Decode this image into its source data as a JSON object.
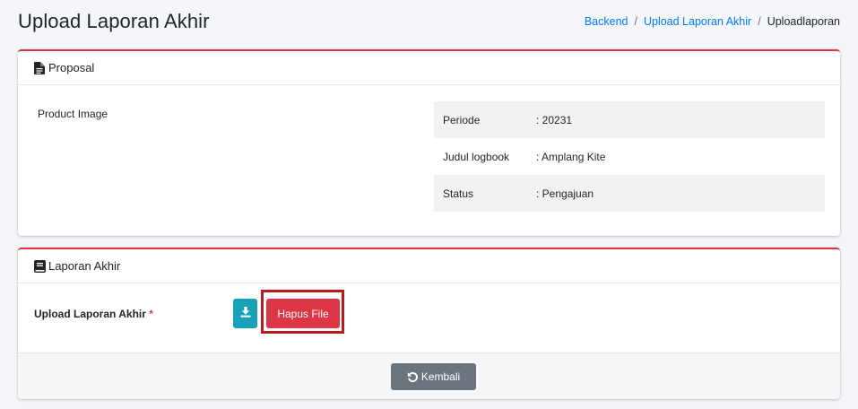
{
  "page": {
    "title": "Upload Laporan Akhir",
    "breadcrumb": {
      "items": [
        "Backend",
        "Upload Laporan Akhir"
      ],
      "current": "Uploadlaporan",
      "separator": "/"
    }
  },
  "proposal": {
    "header": "Proposal",
    "header_icon": "file-text-icon",
    "product_image_label": "Product Image",
    "details": [
      {
        "key": "Periode",
        "value": ": 20231"
      },
      {
        "key": "Judul logbook",
        "value": ": Amplang Kite"
      },
      {
        "key": "Status",
        "value": ": Pengajuan"
      }
    ]
  },
  "laporan": {
    "header": "Laporan Akhir",
    "header_icon": "book-icon",
    "upload_label": "Upload Laporan Akhir",
    "required_mark": "*",
    "download_icon": "download-icon",
    "delete_button": "Hapus File",
    "back_button": "Kembali",
    "back_icon": "undo-icon"
  },
  "colors": {
    "primary_link": "#007bff",
    "danger": "#dc3545",
    "info": "#17a2b8",
    "secondary": "#6c757d",
    "highlight": "#b71c1c"
  }
}
